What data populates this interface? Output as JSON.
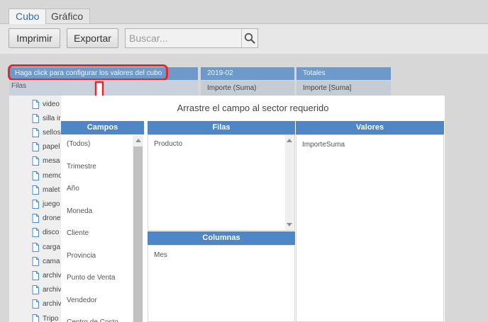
{
  "tabs": [
    {
      "label": "Cubo",
      "active": true
    },
    {
      "label": "Gráfico",
      "active": false
    }
  ],
  "toolbar": {
    "print_label": "Imprimir",
    "export_label": "Exportar",
    "search_placeholder": "Buscar..."
  },
  "pivot": {
    "config_hint": "Haga click para configurar los valores del cubo",
    "rows_label": "Filas",
    "column_header": "2019-02",
    "totals_header": "Totales",
    "measure_label_1": "Importe (Suma)",
    "measure_label_2": "Importe [Suma]",
    "row_items": [
      "video",
      "silla ir",
      "sellos",
      "papel",
      "mesa",
      "memo",
      "malet",
      "juego",
      "drone",
      "disco",
      "carga",
      "cama",
      "archiv",
      "archiv",
      "archiv",
      "Tripo"
    ]
  },
  "dialog": {
    "title": "Arrastre el campo al sector requerido",
    "fields_header": "Campos",
    "fields": [
      "(Todos)",
      "Trimestre",
      "Año",
      "Moneda",
      "Cliente",
      "Provincia",
      "Punto de Venta",
      "Vendedor",
      "Centro de Costo"
    ],
    "rows_header": "Filas",
    "rows_items": [
      "Producto"
    ],
    "columns_header": "Columnas",
    "columns_items": [
      "Mes"
    ],
    "values_header": "Valores",
    "values_items": [
      "ImporteSuma"
    ]
  },
  "colors": {
    "accent_blue": "#4f86c6",
    "header_blue": "#6d9acb",
    "highlight_red": "#e5262a",
    "tab_active_text": "#2d6fb8"
  }
}
